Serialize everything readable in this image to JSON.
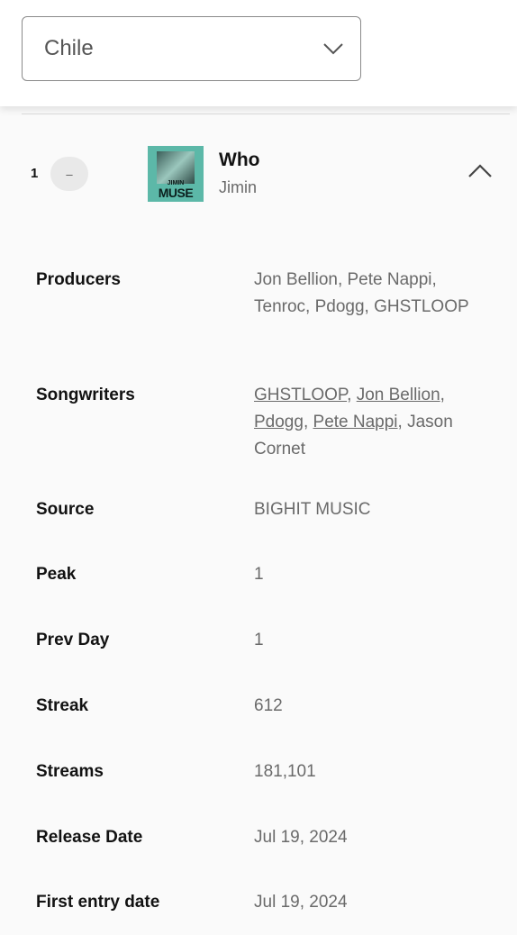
{
  "country_select": {
    "value": "Chile"
  },
  "track": {
    "rank": "1",
    "movement": "–",
    "title": "Who",
    "artist": "Jimin",
    "cover_text_small": "JIMIN",
    "cover_text_large": "MUSE"
  },
  "details": {
    "producers": {
      "label": "Producers",
      "value": "Jon Bellion, Pete Nappi, Tenroc, Pdogg, GHSTLOOP"
    },
    "songwriters": {
      "label": "Songwriters",
      "links": [
        "GHSTLOOP",
        "Jon Bellion",
        "Pdogg",
        "Pete Nappi"
      ],
      "extra": "Jason Cornet"
    },
    "source": {
      "label": "Source",
      "value": "BIGHIT MUSIC"
    },
    "peak": {
      "label": "Peak",
      "value": "1"
    },
    "prev_day": {
      "label": "Prev Day",
      "value": "1"
    },
    "streak": {
      "label": "Streak",
      "value": "612"
    },
    "streams": {
      "label": "Streams",
      "value": "181,101"
    },
    "release_date": {
      "label": "Release Date",
      "value": "Jul 19, 2024"
    },
    "first_entry_date": {
      "label": "First entry date",
      "value": "Jul 19, 2024"
    }
  }
}
